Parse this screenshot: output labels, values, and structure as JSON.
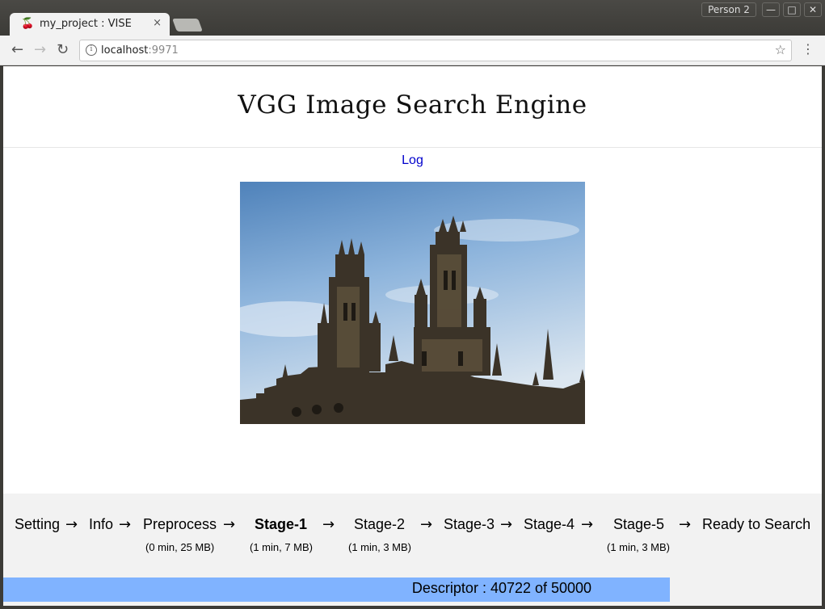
{
  "browser": {
    "tab_title": "my_project : VISE",
    "tab_close": "×",
    "profile": "Person 2",
    "url_host": "localhost",
    "url_port": ":9971",
    "win_min": "—",
    "win_max": "□",
    "win_close": "✕",
    "back": "←",
    "forward": "→",
    "reload": "↻",
    "info_icon": "i",
    "star_icon": "☆",
    "menu_icon": "⋮",
    "favicon": "🍒"
  },
  "page": {
    "title": "VGG Image Search Engine",
    "log_link": "Log"
  },
  "stages": {
    "items": [
      {
        "label": "Setting"
      },
      {
        "label": "Info"
      },
      {
        "label": "Preprocess",
        "sub": "(0 min, 25 MB)"
      },
      {
        "label": "Stage-1",
        "sub": "(1 min, 7 MB)",
        "active": true
      },
      {
        "label": "Stage-2",
        "sub": "(1 min, 3 MB)"
      },
      {
        "label": "Stage-3"
      },
      {
        "label": "Stage-4"
      },
      {
        "label": "Stage-5",
        "sub": "(1 min, 3 MB)"
      },
      {
        "label": "Ready to Search"
      }
    ],
    "arrow": "→"
  },
  "progress": {
    "text": "Descriptor : 40722 of 50000",
    "fraction": 0.81444,
    "color": "#80b3ff"
  }
}
